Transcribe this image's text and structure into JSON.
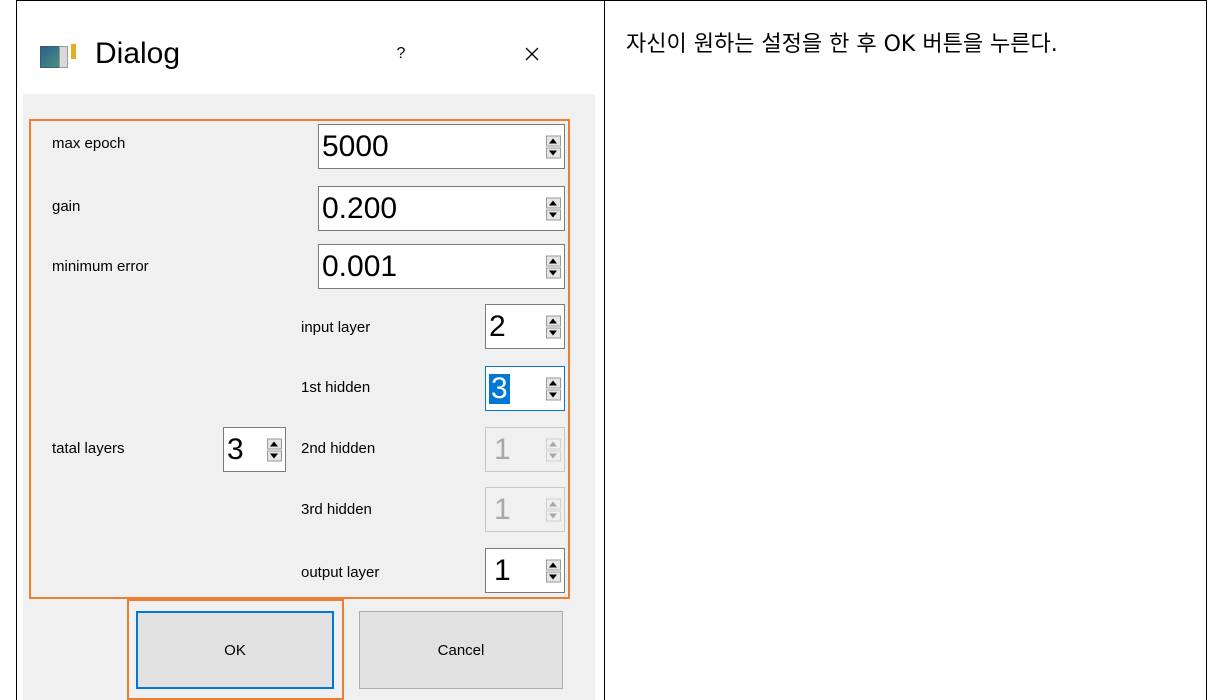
{
  "dialog": {
    "title": "Dialog",
    "help_button": "?",
    "fields": {
      "max_epoch": {
        "label": "max epoch",
        "value": "5000"
      },
      "gain": {
        "label": "gain",
        "value": "0.200"
      },
      "minimum_error": {
        "label": "minimum error",
        "value": "0.001"
      },
      "total_layers": {
        "label": "tatal layers",
        "value": "3"
      },
      "input_layer": {
        "label": "input layer",
        "value": "2"
      },
      "hidden_1": {
        "label": "1st hidden",
        "value": "3"
      },
      "hidden_2": {
        "label": "2nd hidden",
        "value": "1"
      },
      "hidden_3": {
        "label": "3rd hidden",
        "value": "1"
      },
      "output_layer": {
        "label": "output layer",
        "value": "1"
      }
    },
    "buttons": {
      "ok": "OK",
      "cancel": "Cancel"
    },
    "icons": [
      "app-icon",
      "help-icon",
      "close-icon",
      "spin-up-icon",
      "spin-down-icon"
    ],
    "highlight_color": "#ed7d31",
    "focus_color": "#0078d7"
  },
  "instruction_text": "자신이 원하는 설정을 한 후 OK 버튼을 누른다."
}
